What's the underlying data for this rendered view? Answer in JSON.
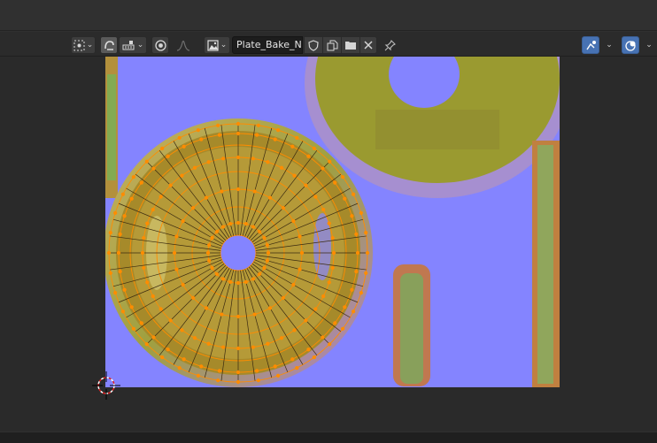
{
  "header": {
    "image_name": "Plate_Bake_N",
    "icons": {
      "pivot": "pivot-point-icon",
      "uv_sync": "uv-sync-selection-icon",
      "snap": "snap-icon",
      "proportional": "proportional-editing-icon",
      "falloff": "falloff-curve-icon",
      "image_browse": "image-browse-icon",
      "fake_user": "fake-user-shield-icon",
      "duplicate": "duplicate-image-icon",
      "open": "open-folder-icon",
      "unlink": "unlink-x-icon",
      "pin": "pin-icon",
      "gizmo": "gizmo-toggle-icon",
      "overlay": "overlay-toggle-icon"
    }
  },
  "colors": {
    "accent": "#4772b3",
    "uv_edge": "#ff8c00",
    "normal_map_bg": "#8484ff",
    "editor_bg": "#2a2a2a"
  },
  "viewport": {
    "content": "normal-map-with-uv-mesh",
    "cursor": "2d-cursor-icon"
  }
}
